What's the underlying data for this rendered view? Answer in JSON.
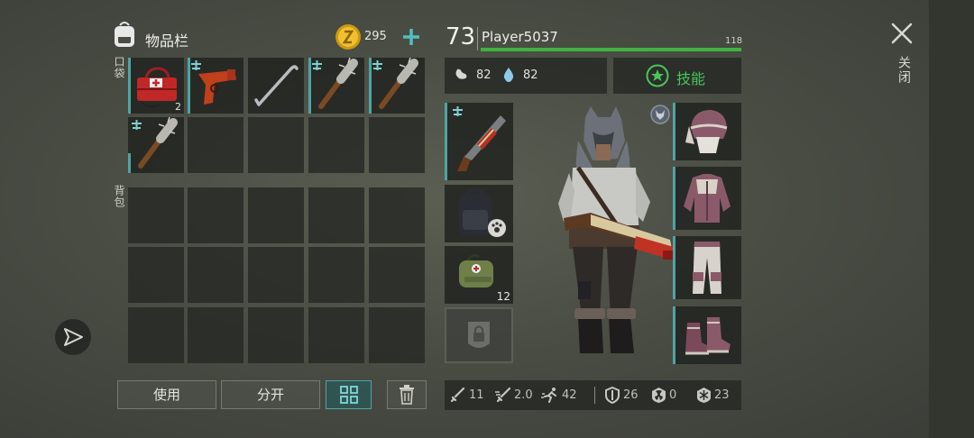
{
  "inventory": {
    "title": "物品栏",
    "coins": "295",
    "pockets_label": "口袋",
    "backpack_label": "背包",
    "first_aid_qty": "2"
  },
  "actions": {
    "use_label": "使用",
    "split_label": "分开"
  },
  "player": {
    "level": "73",
    "name": "Player5037",
    "xp_value": "118",
    "food": "82",
    "water": "82",
    "skills_label": "技能"
  },
  "equipment": {
    "medkit_qty": "12"
  },
  "stats": {
    "damage": "11",
    "attack_speed": "2.0",
    "move_speed": "42",
    "armor": "26",
    "radiation": "0",
    "cold": "23"
  },
  "close_label": "关闭",
  "colors": {
    "accent": "#4ea4a4",
    "xp_bar": "#3fb33f",
    "skills_green": "#49c55a",
    "coin": "#e0b020"
  }
}
